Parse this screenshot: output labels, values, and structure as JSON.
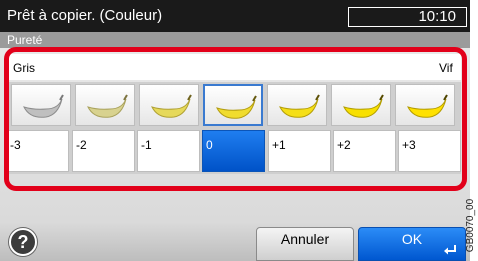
{
  "status": {
    "text": "Prêt à copier. (Couleur)",
    "time": "10:10"
  },
  "title": "Pureté",
  "scale": {
    "left_label": "Gris",
    "right_label": "Vif"
  },
  "levels": [
    "-3",
    "-2",
    "-1",
    "0",
    "+1",
    "+2",
    "+3"
  ],
  "selected_level": "0",
  "buttons": {
    "help": "?",
    "cancel": "Annuler",
    "ok": "OK"
  },
  "figure_code": "GB0070_00",
  "icons": {
    "banana": "banana-icon",
    "help": "help-icon",
    "enter": "enter-icon"
  },
  "colors": {
    "selected": "#0057d0",
    "highlight_frame": "#e2001a",
    "status_bar": "#1a1a1a"
  }
}
